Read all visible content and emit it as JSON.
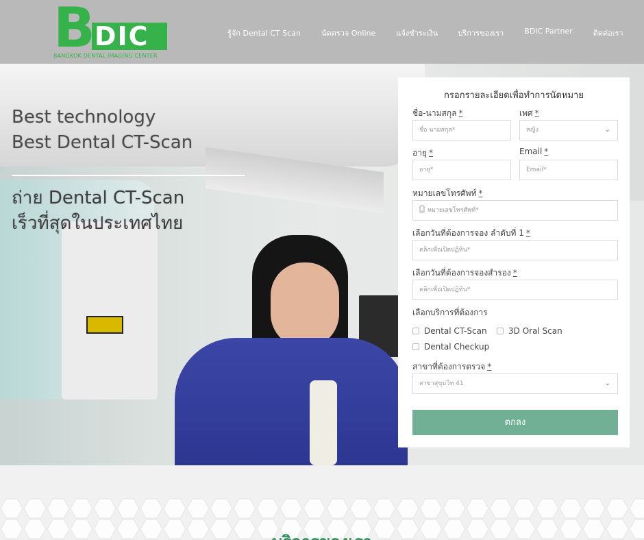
{
  "header": {
    "logo": {
      "letter": "B",
      "suffix": "DIC",
      "tagline": "BANGKOK DENTAL IMAGING CENTER",
      "color": "#35b34a"
    },
    "nav": [
      {
        "label": "รู้จัก Dental CT Scan"
      },
      {
        "label": "นัดตรวจ Online"
      },
      {
        "label": "แจ้งชำระเงิน"
      },
      {
        "label": "บริการของเรา"
      },
      {
        "label": "BDIC Partner"
      },
      {
        "label": "ติดต่อเรา"
      }
    ]
  },
  "hero": {
    "line1": "Best technology",
    "line2": "Best Dental CT-Scan",
    "line3": "ถ่าย Dental CT-Scan",
    "line4": "เร็วที่สุดในประเทศไทย"
  },
  "form": {
    "title": "กรอกรายละเอียดเพื่อทำการนัดหมาย",
    "required_mark": "*",
    "name": {
      "label": "ชื่อ-นามสกุล",
      "placeholder": "ชื่อ นามสกุล*"
    },
    "gender": {
      "label": "เพศ",
      "value": "หญิง"
    },
    "age": {
      "label": "อายุ",
      "placeholder": "อายุ*"
    },
    "email": {
      "label": "Email",
      "placeholder": "Email*"
    },
    "phone": {
      "label": "หมายเลขโทรศัพท์",
      "placeholder": "หมายเลขโทรศัพท์*",
      "icon": "phone-icon"
    },
    "date1": {
      "label": "เลือกวันที่ต้องการจอง ลำดับที่ 1",
      "placeholder": "คลิกเพื่อเปิดปฏิทิน*"
    },
    "date2": {
      "label": "เลือกวันที่ต้องการจองสำรอง",
      "placeholder": "คลิกเพื่อเปิดปฏิทิน*"
    },
    "services": {
      "label": "เลือกบริการที่ต้องการ",
      "options": [
        {
          "label": "Dental CT-Scan",
          "checked": false
        },
        {
          "label": "3D Oral Scan",
          "checked": false
        },
        {
          "label": "Dental Checkup",
          "checked": false
        }
      ]
    },
    "branch": {
      "label": "สาขาที่ต้องการตรวจ",
      "value": "สาขาสุขุมวิท 41"
    },
    "submit_label": "ตกลง",
    "accent": "#72b096"
  },
  "services_section": {
    "title": "บริการของเรา",
    "title_color": "#2f8f5b"
  }
}
